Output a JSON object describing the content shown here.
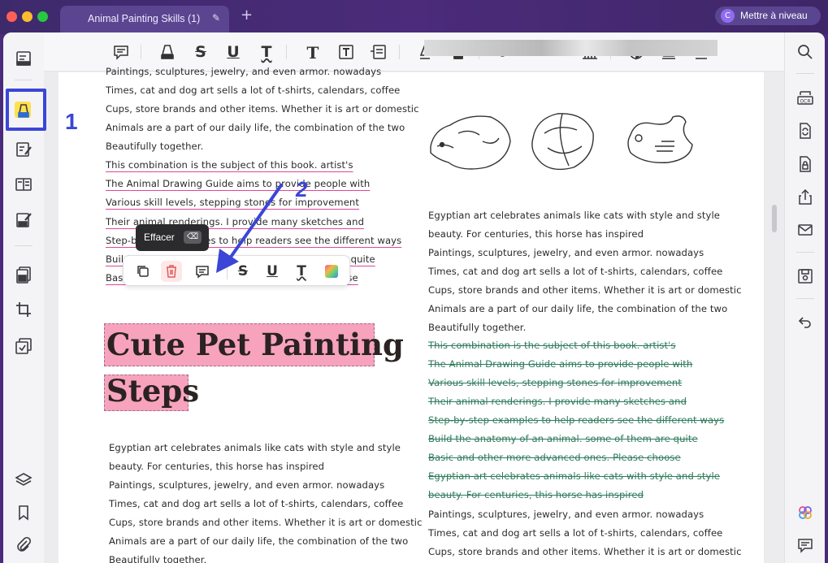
{
  "window": {
    "tab_title": "Animal Painting Skills (1)",
    "tab_add": "+",
    "upgrade_avatar": "C",
    "upgrade_label": "Mettre à niveau"
  },
  "tooltip": {
    "label": "Effacer",
    "key": "⌫"
  },
  "annotations": {
    "step1": "1",
    "step2": "2"
  },
  "heading": {
    "line1": "Cute Pet Painting",
    "line2": "Steps"
  },
  "left_column": {
    "top_lines": [
      "Paintings, sculptures, jewelry, and even armor. nowadays",
      "Times, cat and dog art sells a lot of t-shirts, calendars, coffee",
      "Cups, store brands and other items. Whether it is art or domestic",
      "Animals are a part of our daily life, the combination of the two",
      "Beautifully together."
    ],
    "underlined_lines": [
      "This combination is the subject of this book. artist's",
      "The Animal Drawing Guide aims to provide people with",
      "Various skill levels, stepping stones for improvement",
      "Their animal renderings. I provide many sketches and",
      "Step-by-step examples to help readers see the different ways",
      "Build the anatomy of an animal. some of them are quite",
      "Basic and other more advanced ones. Please choose"
    ],
    "bottom_lines": [
      "Egyptian art celebrates animals like cats with style and style",
      "beauty. For centuries, this horse has inspired",
      "Paintings, sculptures, jewelry, and even armor. nowadays",
      "Times, cat and dog art sells a lot of t-shirts, calendars, coffee",
      "Cups, store brands and other items. Whether it is art or domestic",
      "Animals are a part of our daily life, the combination of the two",
      "Beautifully together."
    ]
  },
  "right_column": {
    "lines": [
      "Egyptian art celebrates animals like cats with style and style",
      "beauty. For centuries, this horse has inspired",
      "Paintings, sculptures, jewelry, and even armor. nowadays",
      "Times, cat and dog art sells a lot of t-shirts, calendars, coffee",
      "Cups, store brands and other items. Whether it is art or domestic",
      "Animals are a part of our daily life, the combination of the two",
      "Beautifully together."
    ],
    "strike_lines": [
      "This combination is the subject of this book. artist's",
      "The Animal Drawing Guide aims to provide people with",
      "Various skill levels, stepping stones for improvement",
      "Their animal renderings. I provide many sketches and",
      "Step-by-step examples to help readers see the different ways",
      "Build the anatomy of an animal. some of them are quite",
      "Basic and other more advanced ones. Please choose",
      "Egyptian art celebrates animals like cats with style and style",
      "beauty. For centuries, this horse has inspired"
    ],
    "after_lines": [
      "Paintings, sculptures, jewelry, and even armor. nowadays",
      "Times, cat and dog art sells a lot of t-shirts, calendars, coffee",
      "Cups, store brands and other items. Whether it is art or domestic"
    ]
  },
  "colors": {
    "accent_blue": "#3b46d6",
    "highlight_pink": "#f7a3bd",
    "underline_pink": "#e0469a",
    "strike_green": "#2f7a5c",
    "active_tool_yellow": "#ffe14d"
  },
  "icons": {
    "left_rail": [
      "reader-mode-icon",
      "highlighter-icon",
      "edit-text-icon",
      "page-layout-icon",
      "form-edit-icon",
      "organize-pages-icon",
      "crop-icon",
      "compress-icon",
      "layers-icon",
      "bookmark-icon",
      "attachment-icon"
    ],
    "toolbar": [
      "comment-icon",
      "highlight-icon",
      "strikethrough-icon",
      "underline-icon",
      "squiggly-icon",
      "text-icon",
      "textbox-icon",
      "callout-icon",
      "pencil-icon",
      "eraser-icon",
      "shape-icon",
      "measure-icon",
      "chart-icon",
      "sticker-icon",
      "stamp-icon",
      "signature-icon"
    ],
    "right_rail": [
      "search-icon",
      "ocr-icon",
      "convert-icon",
      "protect-icon",
      "share-icon",
      "mail-icon",
      "save-icon",
      "undo-icon",
      "ai-assistant-icon",
      "chat-icon"
    ],
    "float_bar": [
      "copy-icon",
      "delete-icon",
      "note-icon",
      "strikethrough-icon",
      "underline-icon",
      "squiggly-icon",
      "color-icon"
    ]
  }
}
